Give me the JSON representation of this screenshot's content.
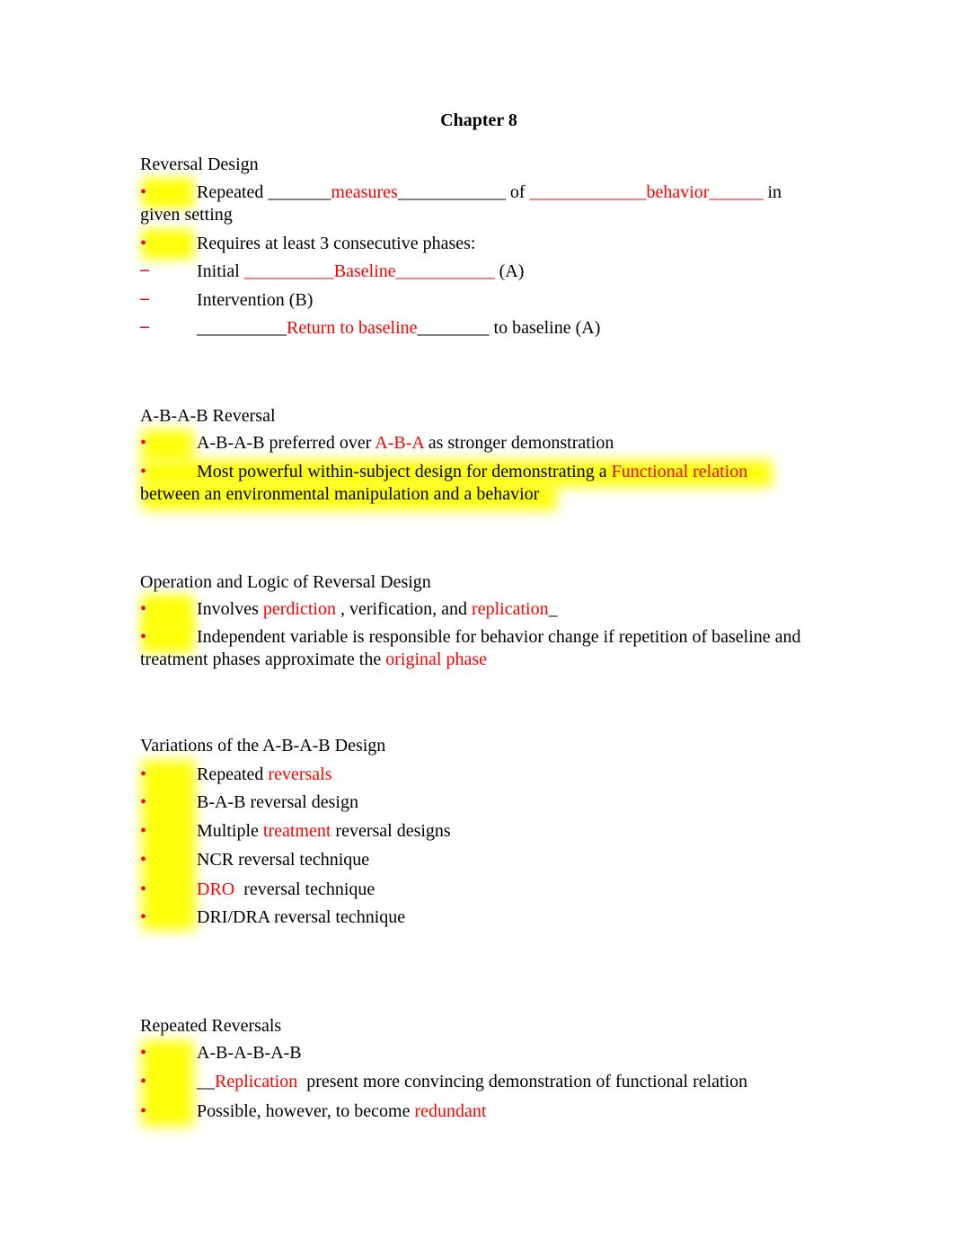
{
  "document": {
    "title": "Chapter 8",
    "colors": {
      "accent_red": "#ff0000",
      "highlight": "#ffff00"
    },
    "sections": [
      {
        "heading": "Reversal Design",
        "items": [
          {
            "marker": "bullet",
            "parts": [
              "Repeated ",
              "_______",
              "measures",
              "____________",
              " of ",
              "_____________",
              "behavior",
              "______",
              " in given setting"
            ]
          },
          {
            "marker": "bullet",
            "parts": [
              "Requires at least 3 consecutive phases:"
            ]
          },
          {
            "marker": "dash",
            "parts": [
              "Initial ",
              "__________",
              "Baseline",
              "___________",
              " (A)"
            ]
          },
          {
            "marker": "dash",
            "parts": [
              "Intervention (B)"
            ]
          },
          {
            "marker": "dash",
            "parts": [
              "__________",
              "Return to baseline",
              "________",
              " to baseline (A)"
            ]
          }
        ]
      },
      {
        "heading": "A-B-A-B Reversal",
        "items": [
          {
            "marker": "bullet",
            "parts": [
              "A-B-A-B preferred over ",
              "A-B-A",
              " as stronger demonstration"
            ]
          },
          {
            "marker": "bullet",
            "parts": [
              "Most powerful within-subject design for demonstrating a ",
              "Functional relation",
              " between an environmental manipulation and a behavior"
            ]
          }
        ]
      },
      {
        "heading": "Operation and Logic of Reversal Design",
        "items": [
          {
            "marker": "bullet",
            "parts": [
              "Involves ",
              "perdiction",
              " , verification, and ",
              "replication",
              "_"
            ]
          },
          {
            "marker": "bullet",
            "parts": [
              "Independent variable is responsible for behavior change if repetition of baseline and treatment phases approximate the ",
              "original phase"
            ]
          }
        ]
      },
      {
        "heading": "Variations of the A-B-A-B Design",
        "items": [
          {
            "marker": "bullet",
            "parts": [
              "Repeated ",
              "reversals"
            ]
          },
          {
            "marker": "bullet",
            "parts": [
              "B-A-B reversal design"
            ]
          },
          {
            "marker": "bullet",
            "parts": [
              "Multiple ",
              "treatment",
              " reversal designs"
            ]
          },
          {
            "marker": "bullet",
            "parts": [
              "NCR reversal technique"
            ]
          },
          {
            "marker": "bullet",
            "parts": [
              "DRO",
              "  reversal technique"
            ]
          },
          {
            "marker": "bullet",
            "parts": [
              "DRI/DRA reversal technique"
            ]
          }
        ]
      },
      {
        "heading": "Repeated Reversals",
        "items": [
          {
            "marker": "bullet",
            "parts": [
              "A-B-A-B-A-B"
            ]
          },
          {
            "marker": "bullet",
            "parts": [
              "__",
              "Replication",
              "  present more convincing demonstration of functional relation"
            ]
          },
          {
            "marker": "bullet",
            "parts": [
              "Possible, however, to become ",
              "redundant"
            ]
          }
        ]
      }
    ]
  }
}
